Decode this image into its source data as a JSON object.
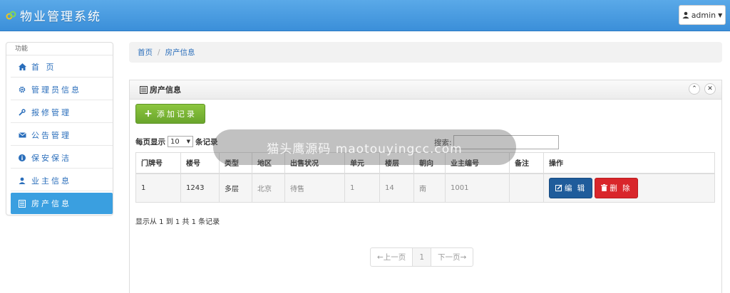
{
  "header": {
    "title": "物业管理系统",
    "user": "admin",
    "colors": {
      "bar": "#3b8fd9"
    }
  },
  "sidebar": {
    "heading": "功能",
    "items": [
      {
        "label": "首 页",
        "icon": "home-icon"
      },
      {
        "label": "管理员信息",
        "icon": "cog-icon"
      },
      {
        "label": "报修管理",
        "icon": "wrench-icon"
      },
      {
        "label": "公告管理",
        "icon": "envelope-icon"
      },
      {
        "label": "保安保洁",
        "icon": "info-icon"
      },
      {
        "label": "业主信息",
        "icon": "user-icon"
      },
      {
        "label": "房产信息",
        "icon": "list-icon",
        "active": true
      }
    ]
  },
  "breadcrumb": {
    "home": "首页",
    "current": "房产信息"
  },
  "panel": {
    "title": "房产信息",
    "add_label": "添加记录",
    "length_prefix": "每页显示",
    "length_value": "10",
    "length_suffix": "条记录",
    "search_label": "搜索:",
    "search_value": "",
    "columns": [
      "门牌号",
      "楼号",
      "类型",
      "地区",
      "出售状况",
      "单元",
      "楼层",
      "朝向",
      "业主编号",
      "备注",
      "操作"
    ],
    "rows": [
      {
        "door": "1",
        "building": "1243",
        "type": "多层",
        "region": "北京",
        "sale": "待售",
        "unit": "1",
        "floor": "14",
        "orient": "南",
        "owner_id": "1001",
        "note": ""
      }
    ],
    "edit_label": "编 辑",
    "delete_label": "删 除",
    "info": "显示从 1 到 1 共 1 条记录",
    "pager": {
      "prev": "←上一页",
      "page": "1",
      "next": "下一页→"
    }
  },
  "watermark": "猫头鹰源码 maotouyingcc.com"
}
